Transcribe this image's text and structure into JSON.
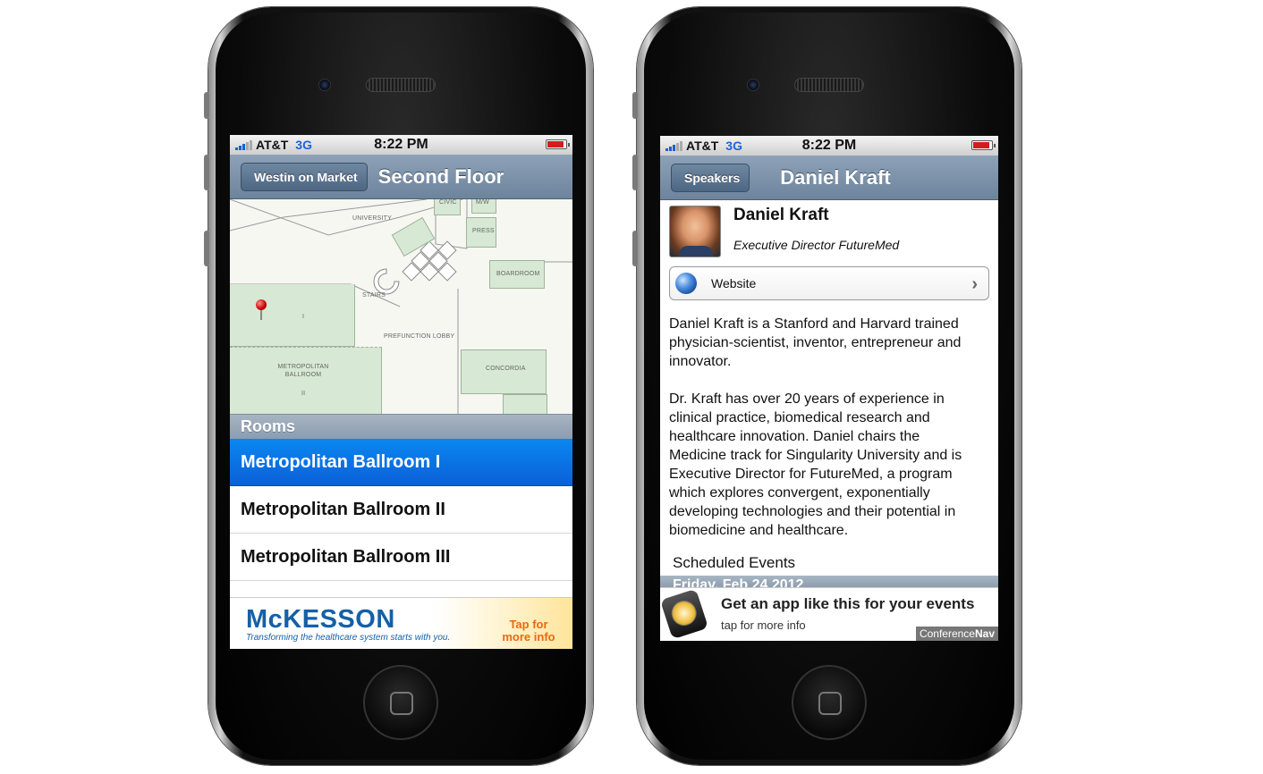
{
  "status": {
    "carrier": "AT&T",
    "network": "3G",
    "time": "8:22 PM"
  },
  "left": {
    "nav": {
      "back_label": "Westin on Market",
      "title": "Second Floor"
    },
    "map": {
      "labels": {
        "civic": "CIVIC",
        "mw": "M/W",
        "university": "UNIVERSITY",
        "press": "PRESS",
        "boardroom": "BOARDROOM",
        "stairs": "STAIRS",
        "room_i": "I",
        "prefunction": "PREFUNCTION LOBBY",
        "metro": "METROPOLITAN BALLROOM",
        "room_ii": "II",
        "concordia": "CONCORDIA"
      }
    },
    "rooms_header": "Rooms",
    "rooms": [
      {
        "label": "Metropolitan Ballroom I"
      },
      {
        "label": "Metropolitan Ballroom II"
      },
      {
        "label": "Metropolitan Ballroom III"
      }
    ],
    "ad": {
      "logo": "McKESSON",
      "tagline": "Transforming the healthcare system starts with you.",
      "tap": "Tap for more info"
    }
  },
  "right": {
    "nav": {
      "back_label": "Speakers",
      "title": "Daniel Kraft"
    },
    "speaker": {
      "name": "Daniel Kraft",
      "title": "Executive Director FutureMed"
    },
    "website_label": "Website",
    "bio": [
      "Daniel Kraft is a Stanford and Harvard trained physician-scientist, inventor, entrepreneur and innovator.",
      "Dr. Kraft has over 20 years of experience in clinical practice, biomedical research and healthcare innovation. Daniel chairs the Medicine track for Singularity University and is Executive Director for FutureMed, a program which explores convergent, exponentially developing technologies and their potential in biomedicine and healthcare."
    ],
    "scheduled_label": "Scheduled Events",
    "day_strip": "Friday, Feb 24 2012",
    "ad": {
      "main": "Get an app like this for your events",
      "sub": "tap for more info",
      "badge_light": "Conference",
      "badge_bold": "Nav"
    }
  }
}
